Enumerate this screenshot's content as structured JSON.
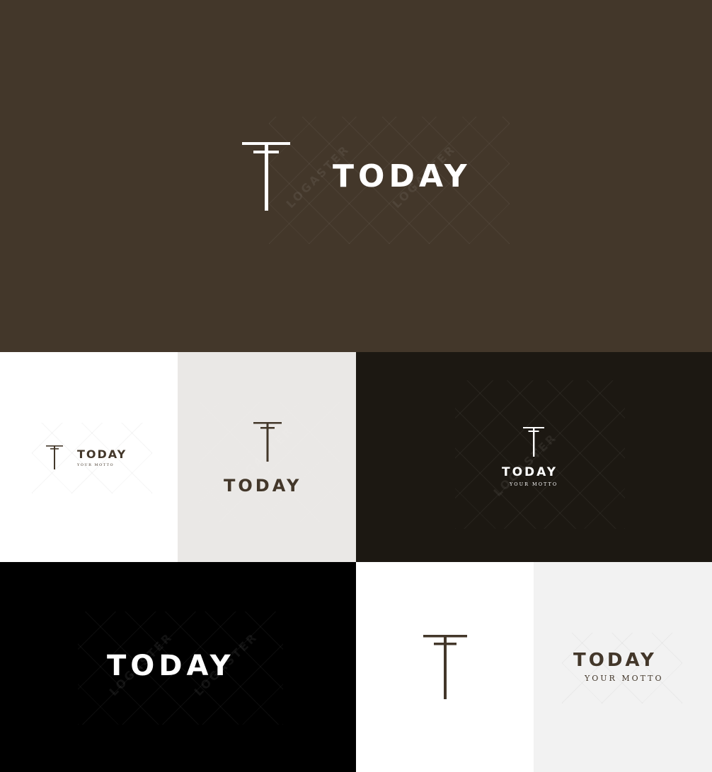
{
  "brand": {
    "name": "TODAY",
    "motto": "YOUR MOTTO",
    "watermark": "LOGASTER"
  },
  "colors": {
    "brown": "#43372a",
    "near_black": "#1c1812",
    "black": "#000000",
    "white": "#ffffff",
    "light_gray": "#eae8e6",
    "off_white": "#f2f2f2",
    "logo_brown": "#43372a"
  },
  "panels": [
    {
      "id": "hero",
      "background": "brown",
      "shows": [
        "monogram",
        "name"
      ]
    },
    {
      "id": "white-small",
      "background": "white",
      "shows": [
        "monogram",
        "name",
        "motto"
      ]
    },
    {
      "id": "gray-stacked",
      "background": "light_gray",
      "shows": [
        "monogram",
        "name"
      ]
    },
    {
      "id": "dark-stacked",
      "background": "near_black",
      "shows": [
        "monogram",
        "name",
        "motto"
      ]
    },
    {
      "id": "black-wordmark",
      "background": "black",
      "shows": [
        "name"
      ]
    },
    {
      "id": "white-monogram",
      "background": "white",
      "shows": [
        "monogram"
      ]
    },
    {
      "id": "offwhite-wordmark",
      "background": "off_white",
      "shows": [
        "name",
        "motto"
      ]
    }
  ]
}
